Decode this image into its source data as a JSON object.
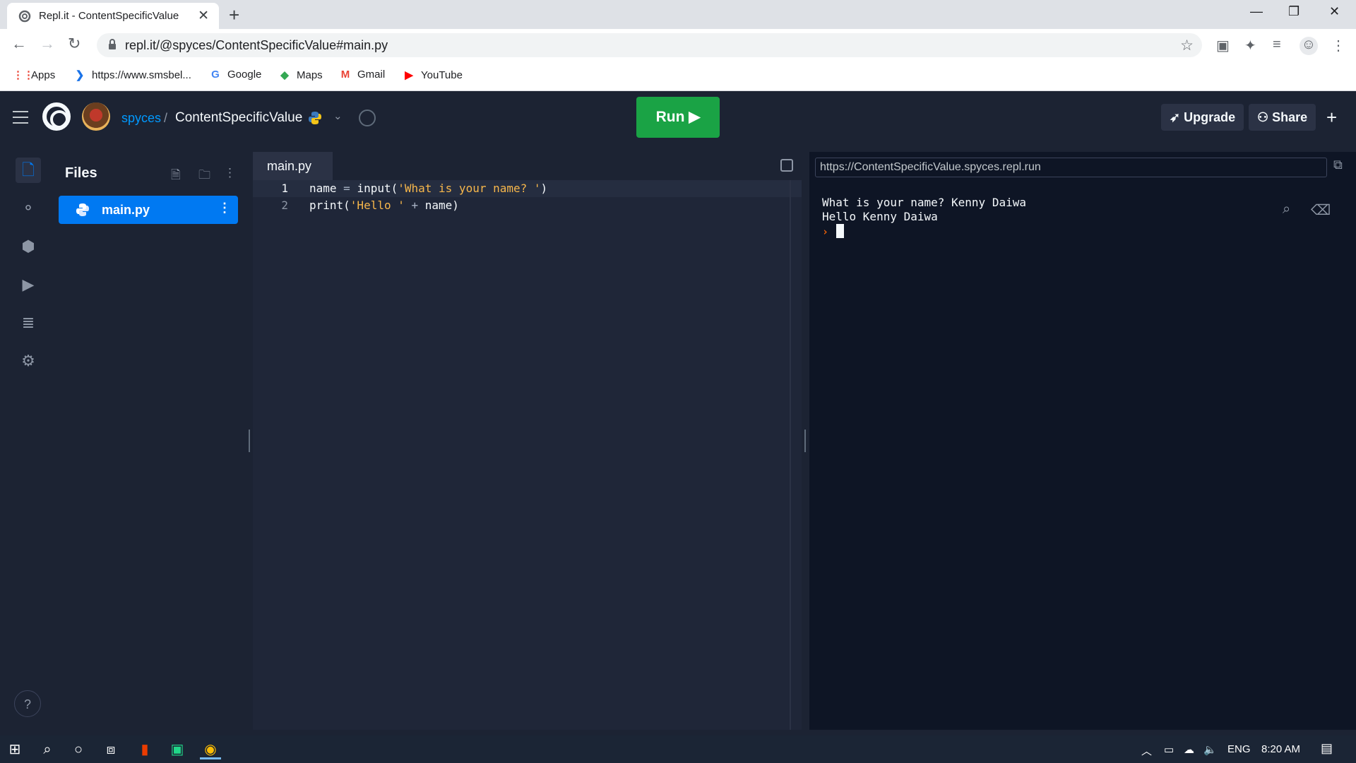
{
  "browser": {
    "tab_title": "Repl.it - ContentSpecificValue",
    "tab_close": "✕",
    "new_tab": "+",
    "window_controls": [
      "—",
      "❐",
      "✕"
    ],
    "url": "repl.it/@spyces/ContentSpecificValue#main.py",
    "bookmarks": [
      {
        "label": "Apps",
        "icon": "apps-grid-icon",
        "color": "#ea4335"
      },
      {
        "label": "https://www.smsbel...",
        "icon": "smsbell-icon",
        "color": "#1a73e8"
      },
      {
        "label": "Google",
        "icon": "google-icon",
        "color": "#4285f4"
      },
      {
        "label": "Maps",
        "icon": "maps-icon",
        "color": "#34a853"
      },
      {
        "label": "Gmail",
        "icon": "gmail-icon",
        "color": "#ea4335"
      },
      {
        "label": "YouTube",
        "icon": "youtube-icon",
        "color": "#ff0000"
      }
    ]
  },
  "header": {
    "owner": "spyces",
    "separator": "/",
    "repl_name": "ContentSpecificValue",
    "run_label": "Run ▶",
    "upgrade_label": "Upgrade",
    "share_label": "Share",
    "plus_label": "+"
  },
  "files": {
    "title": "Files",
    "items": [
      {
        "name": "main.py"
      }
    ]
  },
  "editor": {
    "tab_label": "main.py",
    "lines": [
      {
        "num": "1",
        "parts": [
          {
            "t": "name ",
            "c": "tk-fn"
          },
          {
            "t": "= ",
            "c": "tk-op"
          },
          {
            "t": "input(",
            "c": "tk-fn"
          },
          {
            "t": "'What is your name? '",
            "c": "tk-str"
          },
          {
            "t": ")",
            "c": "tk-fn"
          }
        ]
      },
      {
        "num": "2",
        "parts": [
          {
            "t": "print(",
            "c": "tk-fn"
          },
          {
            "t": "'Hello '",
            "c": "tk-str"
          },
          {
            "t": " + ",
            "c": "tk-op"
          },
          {
            "t": "name)",
            "c": "tk-fn"
          }
        ]
      }
    ]
  },
  "console": {
    "url": "https://ContentSpecificValue.spyces.repl.run",
    "output_lines": [
      "What is your name? Kenny Daiwa",
      "Hello Kenny Daiwa"
    ],
    "prompt": "›"
  },
  "taskbar": {
    "language": "ENG",
    "time": "8:20 AM"
  },
  "colors": {
    "run_button": "#1aa345",
    "accent_blue": "#0079f2",
    "owner_link": "#0099ff",
    "console_bg": "#0e1525",
    "editor_bg": "#1f2638"
  }
}
